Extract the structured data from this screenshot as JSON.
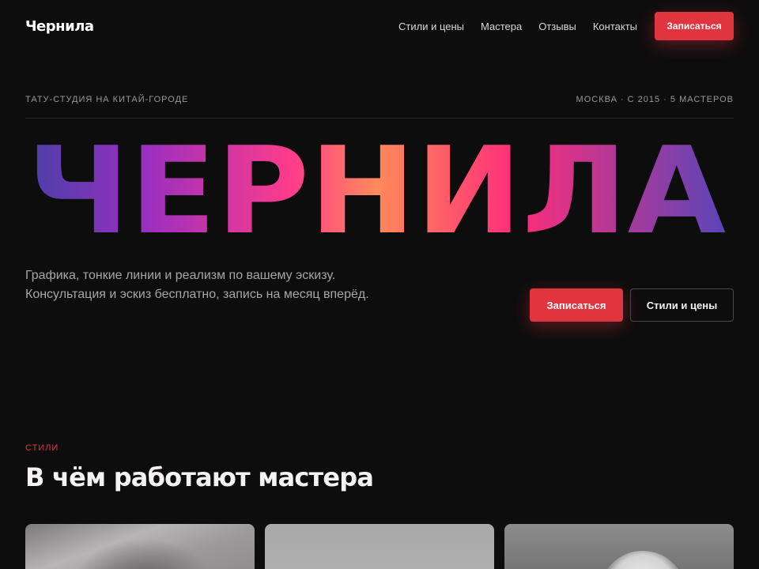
{
  "brand": {
    "logo_text": "Чернила"
  },
  "nav": {
    "items": [
      "Стили и цены",
      "Мастера",
      "Отзывы",
      "Контакты"
    ],
    "cta_label": "Записаться"
  },
  "hero": {
    "tagline": "ТАТУ-СТУДИЯ НА КИТАЙ-ГОРОДЕ",
    "meta": "МОСКВА · С 2015 · 5 МАСТЕРОВ",
    "title": "ЧЕРНИЛА",
    "description": "Графика, тонкие линии и реализм по вашему эскизу. Консультация и эскиз бесплатно, запись на месяц вперёд.",
    "primary_label": "Записаться",
    "secondary_label": "Стили и цены"
  },
  "styles_section": {
    "eyebrow": "СТИЛИ",
    "title": "В чём работают мастера"
  },
  "colors": {
    "accent": "#e0353e",
    "background": "#0e0d0e",
    "gradient": [
      "#4b3fa8",
      "#9a2fbf",
      "#ff3c8a",
      "#ff8a5a",
      "#ff2d7a",
      "#5a45b8"
    ]
  }
}
